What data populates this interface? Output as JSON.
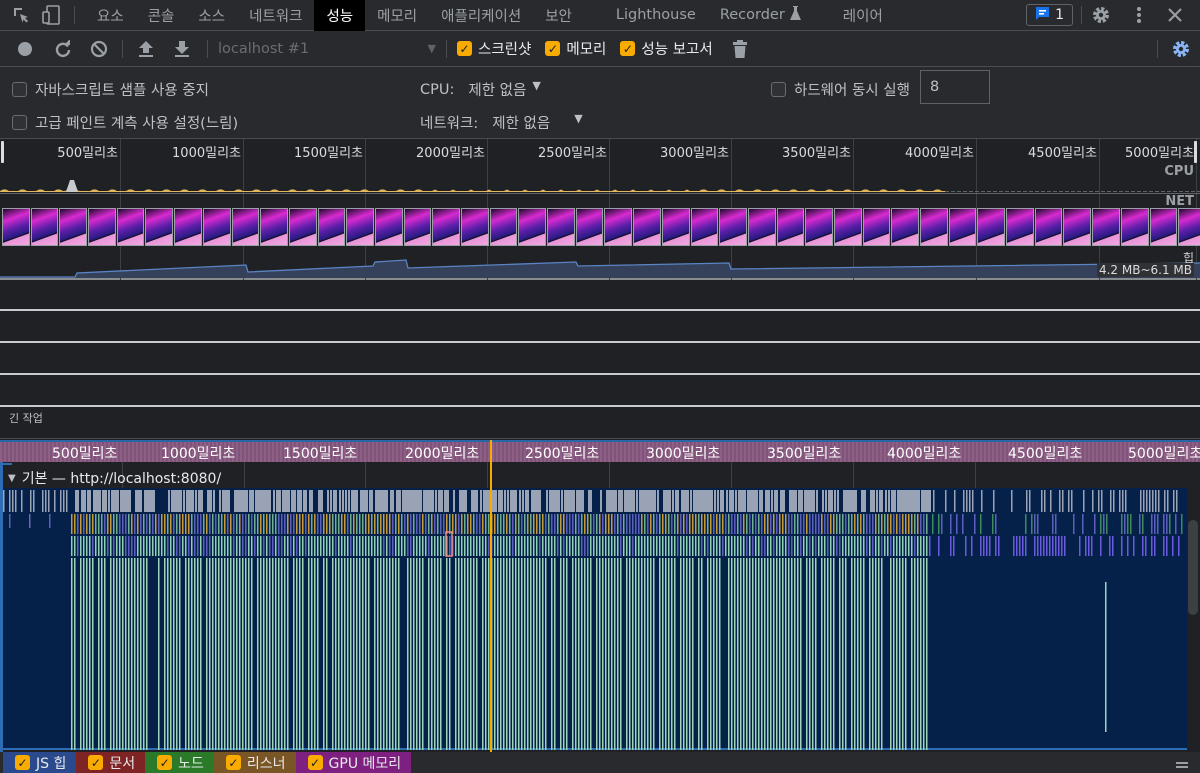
{
  "tabbar": {
    "tabs": [
      {
        "label": "요소"
      },
      {
        "label": "콘솔"
      },
      {
        "label": "소스"
      },
      {
        "label": "네트워크"
      },
      {
        "label": "성능",
        "active": true
      },
      {
        "label": "메모리"
      },
      {
        "label": "애플리케이션"
      },
      {
        "label": "보안"
      },
      {
        "label": "Lighthouse"
      },
      {
        "label": "Recorder"
      },
      {
        "label": "레이어"
      }
    ],
    "issues_count": "1",
    "icons": [
      "inspect-element-icon",
      "device-toolbar-icon",
      "flask-icon",
      "message-icon",
      "gear-icon",
      "kebab-menu-icon",
      "close-icon"
    ]
  },
  "toolbar": {
    "target_select": "localhost #1",
    "screenshots_label": "스크린샷",
    "screenshots_checked": true,
    "memory_label": "메모리",
    "memory_checked": true,
    "web_vitals_label": "성능 보고서",
    "web_vitals_checked": true
  },
  "settings": {
    "disable_js_samples": "자바스크립트 샘플 사용 중지",
    "advanced_paint": "고급 페인트 계측 사용 설정(느림)",
    "cpu_label": "CPU:",
    "cpu_value": "제한 없음",
    "network_label": "네트워크:",
    "network_value": "제한 없음",
    "hardware_concurrency_label": "하드웨어 동시 실행",
    "hardware_concurrency_value": "8"
  },
  "overview": {
    "ticks": [
      "500밀리초",
      "1000밀리초",
      "1500밀리초",
      "2000밀리초",
      "2500밀리초",
      "3000밀리초",
      "3500밀리초",
      "4000밀리초",
      "4500밀리초",
      "5000밀리초"
    ],
    "cpu_label": "CPU",
    "net_label": "NET",
    "heap_label": "힙",
    "heap_range": "4.2 MB~6.1 MB",
    "frame_count": 42
  },
  "tracks": {
    "long_tasks_label": "긴 작업"
  },
  "main": {
    "ticks": [
      "500밀리초",
      "1000밀리초",
      "1500밀리초",
      "2000밀리초",
      "2500밀리초",
      "3000밀리초",
      "3500밀리초",
      "4000밀리초",
      "4500밀리초",
      "5000밀리초"
    ],
    "thread_label": "기본 — http://localhost:8080/"
  },
  "legend": {
    "items": [
      {
        "label": "JS 힙",
        "color": "#2a4a8d"
      },
      {
        "label": "문서",
        "color": "#7f2424"
      },
      {
        "label": "노드",
        "color": "#2a7a2a"
      },
      {
        "label": "리스너",
        "color": "#7a5525"
      },
      {
        "label": "GPU 메모리",
        "color": "#7e2080"
      }
    ]
  }
}
